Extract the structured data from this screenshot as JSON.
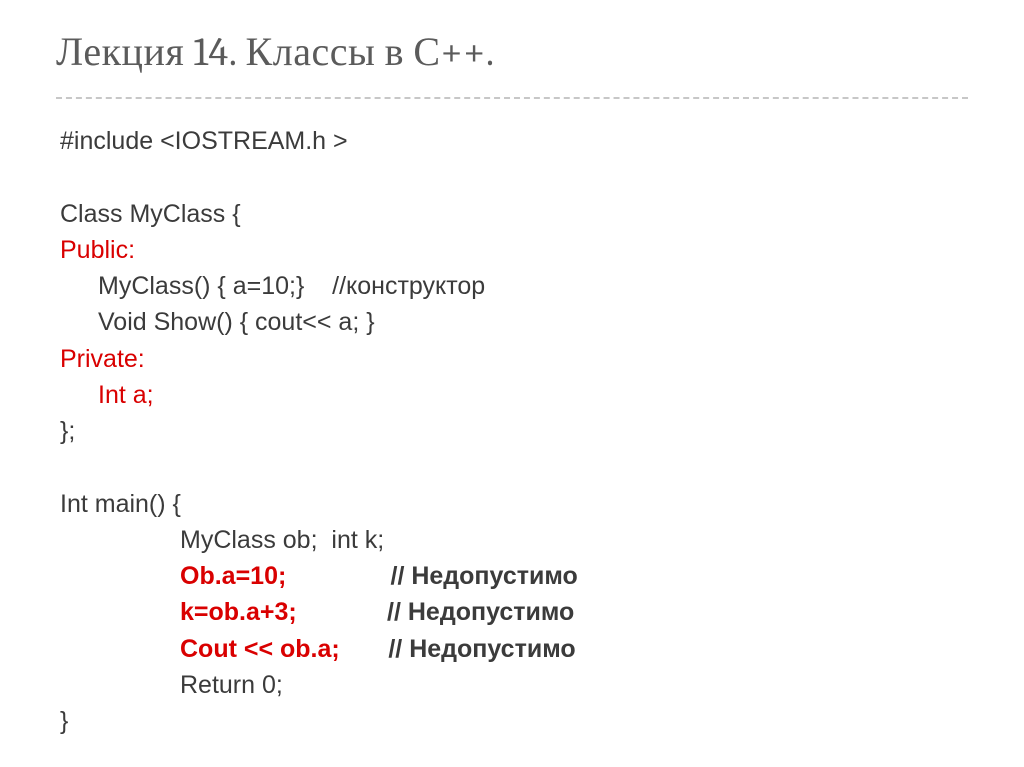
{
  "title": "Лекция 14. Классы в С++.",
  "code": {
    "l1": "#include <IOSTREAM.h >",
    "l2": "Class MyClass {",
    "l3": "Public:",
    "l4a": "MyClass() { a=10;}    ",
    "l4b": "//конструктор",
    "l5": "Void Show() { cout<< a; }",
    "l6": "Private:",
    "l7": "Int a;",
    "l8": "};",
    "l9": "Int main() {",
    "l10": "MyClass ob;  int k;",
    "l11a": "Ob.a=10;",
    "l11b": "// Недопустимо",
    "l12a": "k=ob.a+3;",
    "l12b": "// Недопустимо",
    "l13a": "Cout << ob.a;",
    "l13b": "// Недопустимо",
    "l14": "Return 0;",
    "l15": "}"
  }
}
